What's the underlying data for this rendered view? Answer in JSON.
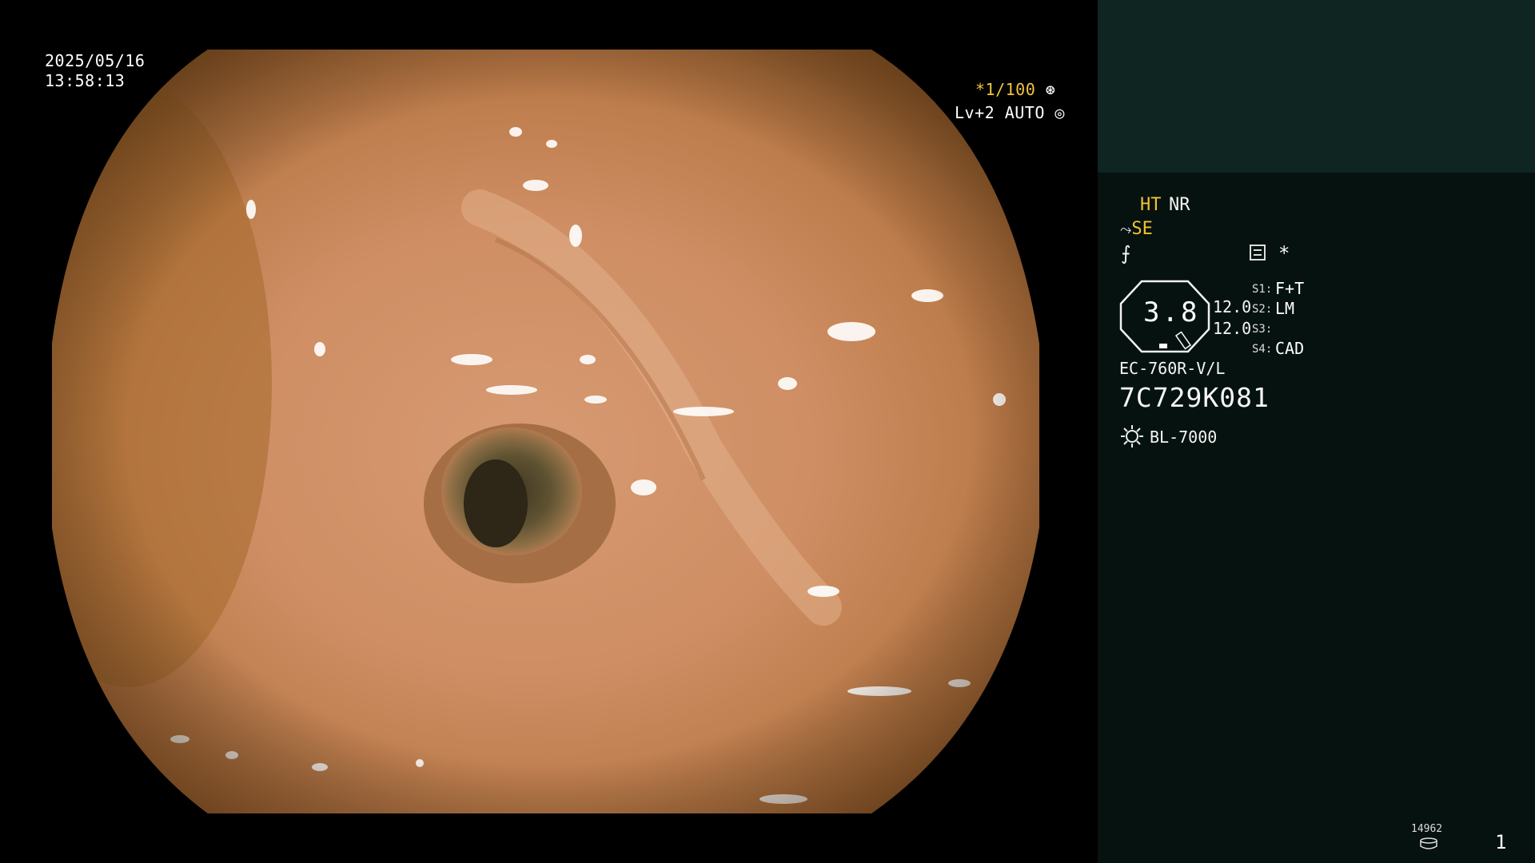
{
  "overlay": {
    "date": "2025/05/16",
    "time": "13:58:13",
    "shutter": "*1/100",
    "shutter_icon": "aperture-icon",
    "level": "Lv+2 AUTO",
    "level_icon": "iris-icon"
  },
  "panel": {
    "ht": "HT",
    "nr": "NR",
    "se": "SE",
    "se_icon": "structure-enhancement-icon",
    "flow_icon": "flow-icon",
    "flow_glyph": "⨍",
    "scale_icon": "scale-icon",
    "star": "*",
    "dial_value": "3.8",
    "value_1": "12.0",
    "value_2": "12.0",
    "switches": [
      {
        "label": "S1:",
        "value": "F+T"
      },
      {
        "label": "S2:",
        "value": "LM"
      },
      {
        "label": "S3:",
        "value": ""
      },
      {
        "label": "S4:",
        "value": "CAD"
      }
    ],
    "model": "EC-760R-V/L",
    "serial": "7C729K081",
    "light_icon": "light-source-icon",
    "light_source": "BL-7000"
  },
  "footer": {
    "counter": "14962",
    "disk_icon": "storage-icon",
    "page": "1"
  },
  "colors": {
    "accent_yellow": "#f1c232",
    "panel_bg": "#06120f",
    "panel_top_bg": "#0e2521"
  }
}
